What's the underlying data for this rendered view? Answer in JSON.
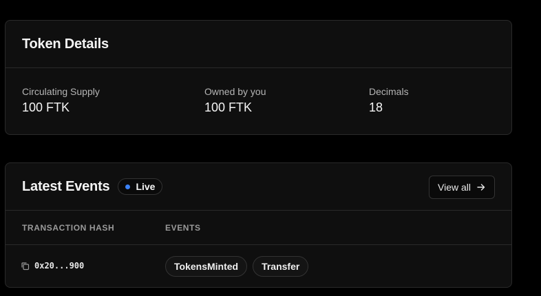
{
  "token_details": {
    "title": "Token Details",
    "stats": [
      {
        "label": "Circulating Supply",
        "value": "100 FTK"
      },
      {
        "label": "Owned by you",
        "value": "100 FTK"
      },
      {
        "label": "Decimals",
        "value": "18"
      }
    ]
  },
  "latest_events": {
    "title": "Latest Events",
    "live_label": "Live",
    "view_all_label": "View all",
    "columns": [
      "TRANSACTION HASH",
      "EVENTS"
    ],
    "rows": [
      {
        "hash": "0x20...900",
        "events": [
          "TokensMinted",
          "Transfer"
        ]
      }
    ]
  },
  "colors": {
    "background": "#000000",
    "card": "#0f0f0f",
    "border": "#2a2a2a",
    "live_dot": "#3b82f6"
  },
  "icons": {
    "copy": "copy-icon",
    "view_all": "arrow-right-icon",
    "live": "live-dot-icon"
  }
}
